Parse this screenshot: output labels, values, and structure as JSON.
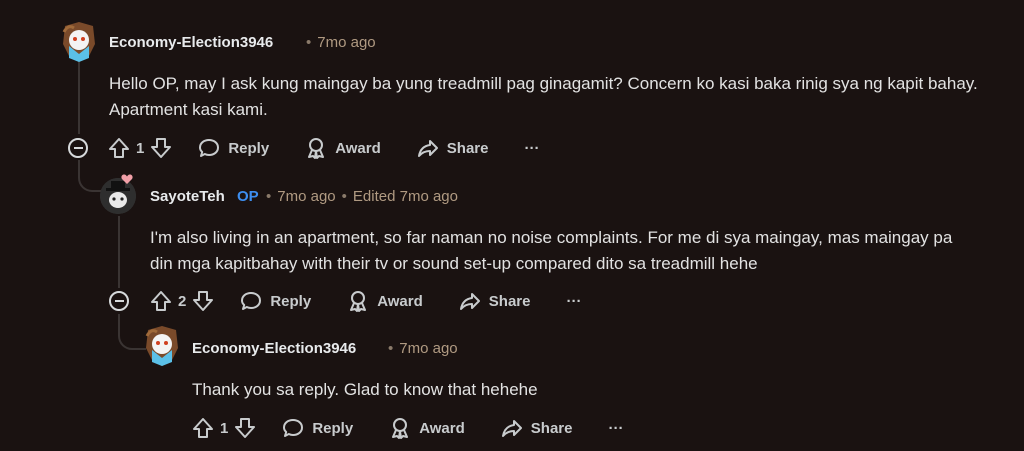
{
  "comments": [
    {
      "username": "Economy-Election3946",
      "time": "7mo ago",
      "op_badge": "",
      "edited": "",
      "text": "Hello OP, may I ask kung maingay ba yung treadmill pag ginagamit? Concern ko kasi baka rinig sya ng kapit bahay. Apartment kasi kami.",
      "votes": "1"
    },
    {
      "username": "SayoteTeh",
      "time": "7mo ago",
      "op_badge": "OP",
      "edited": "Edited 7mo ago",
      "text": "I'm also living in an apartment, so far naman no noise complaints. For me di sya maingay, mas maingay pa din mga kapitbahay with their tv or sound set-up compared dito sa treadmill hehe",
      "votes": "2"
    },
    {
      "username": "Economy-Election3946",
      "time": "7mo ago",
      "op_badge": "",
      "edited": "",
      "text": "Thank you sa reply. Glad to know that hehehe",
      "votes": "1"
    }
  ],
  "actions": {
    "reply": "Reply",
    "award": "Award",
    "share": "Share",
    "more": "···"
  },
  "dot": "•"
}
